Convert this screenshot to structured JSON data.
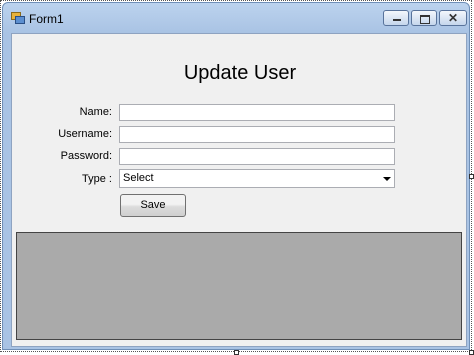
{
  "window": {
    "title": "Form1",
    "icons": {
      "app": "form-icon",
      "minimize": "minimize-icon",
      "maximize": "maximize-icon",
      "close": "close-icon"
    },
    "close_glyph": "✕"
  },
  "form": {
    "heading": "Update User",
    "name_label": "Name:",
    "name_value": "",
    "username_label": "Username:",
    "username_value": "",
    "password_label": "Password:",
    "password_value": "",
    "type_label": "Type :",
    "type_selected": "Select",
    "save_label": "Save"
  },
  "colors": {
    "client_bg": "#f0f0f0",
    "panel_bg": "#aaaaaa",
    "title_bar": "#bcd3ee"
  }
}
